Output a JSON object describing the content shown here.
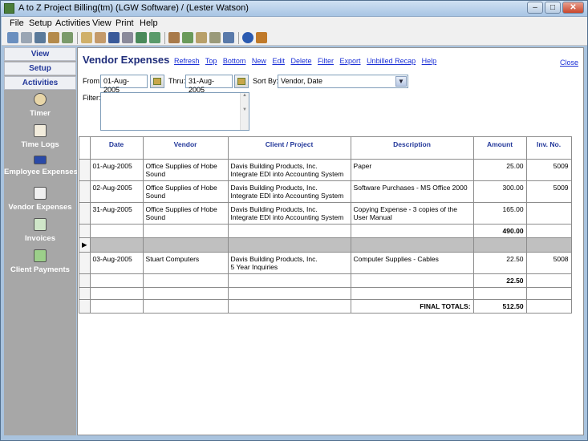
{
  "window": {
    "title": "A to Z Project Billing(tm)   (LGW Software) / (Lester Watson)"
  },
  "menu": [
    "File",
    "Setup",
    "Activities",
    "View",
    "Print",
    "Help"
  ],
  "sidebar": {
    "headers": [
      "View",
      "Setup",
      "Activities"
    ],
    "items": [
      {
        "label": "Timer",
        "icon": "timer-icon"
      },
      {
        "label": "Time Logs",
        "icon": "time-logs-icon"
      },
      {
        "label": "Employee Expenses",
        "icon": "employee-expenses-icon"
      },
      {
        "label": "Vendor Expenses",
        "icon": "vendor-expenses-icon"
      },
      {
        "label": "Invoices",
        "icon": "invoices-icon"
      },
      {
        "label": "Client Payments",
        "icon": "client-payments-icon"
      }
    ]
  },
  "page": {
    "title": "Vendor Expenses",
    "links": [
      "Refresh",
      "Top",
      "Bottom",
      "New",
      "Edit",
      "Delete",
      "Filter",
      "Export",
      "Unbilled Recap",
      "Help"
    ],
    "close": "Close"
  },
  "filters": {
    "from_label": "From:",
    "from_value": "01-Aug-2005",
    "thru_label": "Thru:",
    "thru_value": "31-Aug-2005",
    "sort_label": "Sort By:",
    "sort_value": "Vendor, Date",
    "filter_label": "Filter:"
  },
  "grid": {
    "columns": [
      "Date",
      "Vendor",
      "Client / Project",
      "Description",
      "Amount",
      "Inv. No."
    ],
    "rows": [
      {
        "date": "01-Aug-2005",
        "vendor": "Office Supplies of Hobe Sound",
        "client": "Davis Building Products, Inc.",
        "project": "Integrate EDI into Accounting System",
        "description": "Paper",
        "amount": "25.00",
        "inv": "5009"
      },
      {
        "date": "02-Aug-2005",
        "vendor": "Office Supplies of Hobe Sound",
        "client": "Davis Building Products, Inc.",
        "project": "Integrate EDI into Accounting System",
        "description": "Software Purchases - MS Office 2000",
        "amount": "300.00",
        "inv": "5009"
      },
      {
        "date": "31-Aug-2005",
        "vendor": "Office Supplies of Hobe Sound",
        "client": "Davis Building Products, Inc.",
        "project": "Integrate EDI into Accounting System",
        "description": "Copying Expense - 3 copies of the User Manual",
        "amount": "165.00",
        "inv": ""
      },
      {
        "subtotal": "490.00"
      },
      {
        "date": "03-Aug-2005",
        "vendor": "Stuart Computers",
        "client": "Davis Building Products, Inc.",
        "project": "5 Year Inquiries",
        "description": "Computer Supplies - Cables",
        "amount": "22.50",
        "inv": "5008"
      },
      {
        "subtotal": "22.50"
      }
    ],
    "final_label": "FINAL TOTALS:",
    "final_value": "512.50"
  }
}
